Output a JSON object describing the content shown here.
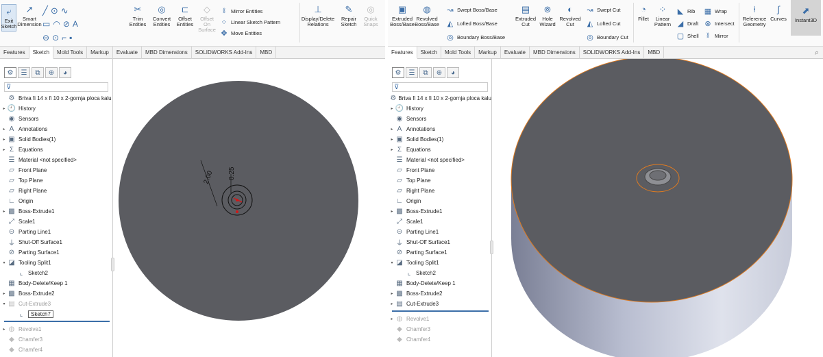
{
  "left": {
    "ribbon": {
      "exit_sketch": "Exit Sketch",
      "smart_dimension": "Smart Dimension",
      "trim_entities": "Trim Entities",
      "convert_entities": "Convert Entities",
      "offset_entities": "Offset Entities",
      "offset_on_surface": "Offset On Surface",
      "mirror_entities": "Mirror Entities",
      "linear_sketch_pattern": "Linear Sketch Pattern",
      "move_entities": "Move Entities",
      "display_delete_relations": "Display/Delete Relations",
      "repair_sketch": "Repair Sketch",
      "quick_snaps": "Quick Snaps"
    },
    "tabs": [
      "Features",
      "Sketch",
      "Mold Tools",
      "Markup",
      "Evaluate",
      "MBD Dimensions",
      "SOLIDWORKS Add-Ins",
      "MBD"
    ],
    "active_tab": "Sketch",
    "tree": [
      {
        "label": "Brtva fi 14 x fi 10 x 2-gornja ploca kalu",
        "icon": "part-icon"
      },
      {
        "label": "History",
        "icon": "history-icon"
      },
      {
        "label": "Sensors",
        "icon": "sensor-icon"
      },
      {
        "label": "Annotations",
        "icon": "annotation-icon"
      },
      {
        "label": "Solid Bodies(1)",
        "icon": "solid-bodies-icon"
      },
      {
        "label": "Equations",
        "icon": "equation-icon"
      },
      {
        "label": "Material <not specified>",
        "icon": "material-icon"
      },
      {
        "label": "Front Plane",
        "icon": "plane-icon"
      },
      {
        "label": "Top Plane",
        "icon": "plane-icon"
      },
      {
        "label": "Right Plane",
        "icon": "plane-icon"
      },
      {
        "label": "Origin",
        "icon": "origin-icon"
      },
      {
        "label": "Boss-Extrude1",
        "icon": "extrude-icon"
      },
      {
        "label": "Scale1",
        "icon": "scale-icon"
      },
      {
        "label": "Parting Line1",
        "icon": "parting-line-icon"
      },
      {
        "label": "Shut-Off Surface1",
        "icon": "shutoff-icon"
      },
      {
        "label": "Parting Surface1",
        "icon": "parting-surface-icon"
      },
      {
        "label": "Tooling Split1",
        "icon": "tooling-split-icon"
      },
      {
        "label": "Sketch2",
        "icon": "sketch-icon"
      },
      {
        "label": "Body-Delete/Keep 1",
        "icon": "body-delete-icon"
      },
      {
        "label": "Boss-Extrude2",
        "icon": "extrude-icon"
      },
      {
        "label": "Cut-Extrude3",
        "icon": "cut-extrude-icon"
      },
      {
        "label": "Sketch7",
        "icon": "sketch-icon"
      },
      {
        "label": "Revolve1",
        "icon": "revolve-icon"
      },
      {
        "label": "Chamfer3",
        "icon": "chamfer-icon"
      },
      {
        "label": "Chamfer4",
        "icon": "chamfer-icon"
      }
    ],
    "dimensions": {
      "d1": "2.00",
      "d2": "0.25"
    }
  },
  "right": {
    "ribbon": {
      "extruded_boss": "Extruded Boss/Base",
      "revolved_boss": "Revolved Boss/Base",
      "swept_boss": "Swept Boss/Base",
      "lofted_boss": "Lofted Boss/Base",
      "boundary_boss": "Boundary Boss/Base",
      "extruded_cut": "Extruded Cut",
      "hole_wizard": "Hole Wizard",
      "revolved_cut": "Revolved Cut",
      "swept_cut": "Swept Cut",
      "lofted_cut": "Lofted Cut",
      "boundary_cut": "Boundary Cut",
      "fillet": "Fillet",
      "linear_pattern": "Linear Pattern",
      "rib": "Rib",
      "draft": "Draft",
      "shell": "Shell",
      "wrap": "Wrap",
      "intersect": "Intersect",
      "mirror": "Mirror",
      "reference_geometry": "Reference Geometry",
      "curves": "Curves",
      "instant3d": "Instant3D"
    },
    "tabs": [
      "Features",
      "Sketch",
      "Mold Tools",
      "Markup",
      "Evaluate",
      "MBD Dimensions",
      "SOLIDWORKS Add-Ins",
      "MBD"
    ],
    "active_tab": "Features",
    "tree": [
      {
        "label": "Brtva fi 14 x fi 10 x 2-gornja ploca kalu",
        "icon": "part-icon"
      },
      {
        "label": "History",
        "icon": "history-icon"
      },
      {
        "label": "Sensors",
        "icon": "sensor-icon"
      },
      {
        "label": "Annotations",
        "icon": "annotation-icon"
      },
      {
        "label": "Solid Bodies(1)",
        "icon": "solid-bodies-icon"
      },
      {
        "label": "Equations",
        "icon": "equation-icon"
      },
      {
        "label": "Material <not specified>",
        "icon": "material-icon"
      },
      {
        "label": "Front Plane",
        "icon": "plane-icon"
      },
      {
        "label": "Top Plane",
        "icon": "plane-icon"
      },
      {
        "label": "Right Plane",
        "icon": "plane-icon"
      },
      {
        "label": "Origin",
        "icon": "origin-icon"
      },
      {
        "label": "Boss-Extrude1",
        "icon": "extrude-icon"
      },
      {
        "label": "Scale1",
        "icon": "scale-icon"
      },
      {
        "label": "Parting Line1",
        "icon": "parting-line-icon"
      },
      {
        "label": "Shut-Off Surface1",
        "icon": "shutoff-icon"
      },
      {
        "label": "Parting Surface1",
        "icon": "parting-surface-icon"
      },
      {
        "label": "Tooling Split1",
        "icon": "tooling-split-icon"
      },
      {
        "label": "Sketch2",
        "icon": "sketch-icon"
      },
      {
        "label": "Body-Delete/Keep 1",
        "icon": "body-delete-icon"
      },
      {
        "label": "Boss-Extrude2",
        "icon": "extrude-icon"
      },
      {
        "label": "Cut-Extrude3",
        "icon": "cut-extrude-icon"
      },
      {
        "label": "Revolve1",
        "icon": "revolve-icon"
      },
      {
        "label": "Chamfer3",
        "icon": "chamfer-icon"
      },
      {
        "label": "Chamfer4",
        "icon": "chamfer-icon"
      }
    ]
  },
  "colors": {
    "accent": "#3b6ea8",
    "part_face": "#5b5c61",
    "edge_highlight": "#e07b20",
    "sketch_red": "#d01818"
  }
}
